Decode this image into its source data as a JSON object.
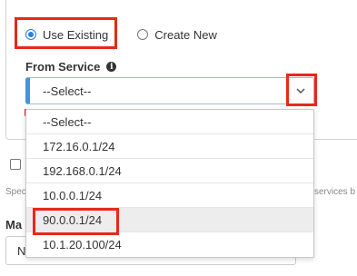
{
  "radio": {
    "use_existing_label": "Use Existing",
    "create_new_label": "Create New"
  },
  "from_service": {
    "label": "From Service",
    "info_icon": "info-icon",
    "selected": "--Select--",
    "options": [
      "--Select--",
      "172.16.0.1/24",
      "192.168.0.1/24",
      "10.0.0.1/24",
      "90.0.0.1/24",
      "10.1.20.100/24"
    ],
    "hovered_option": "90.0.0.1/24"
  },
  "background": {
    "spec_text": "Spec",
    "services_text": "services b",
    "ma_label": "Ma",
    "bottom_input_value": "N"
  },
  "colors": {
    "accent": "#2b7de9",
    "highlight": "#e8281a"
  }
}
